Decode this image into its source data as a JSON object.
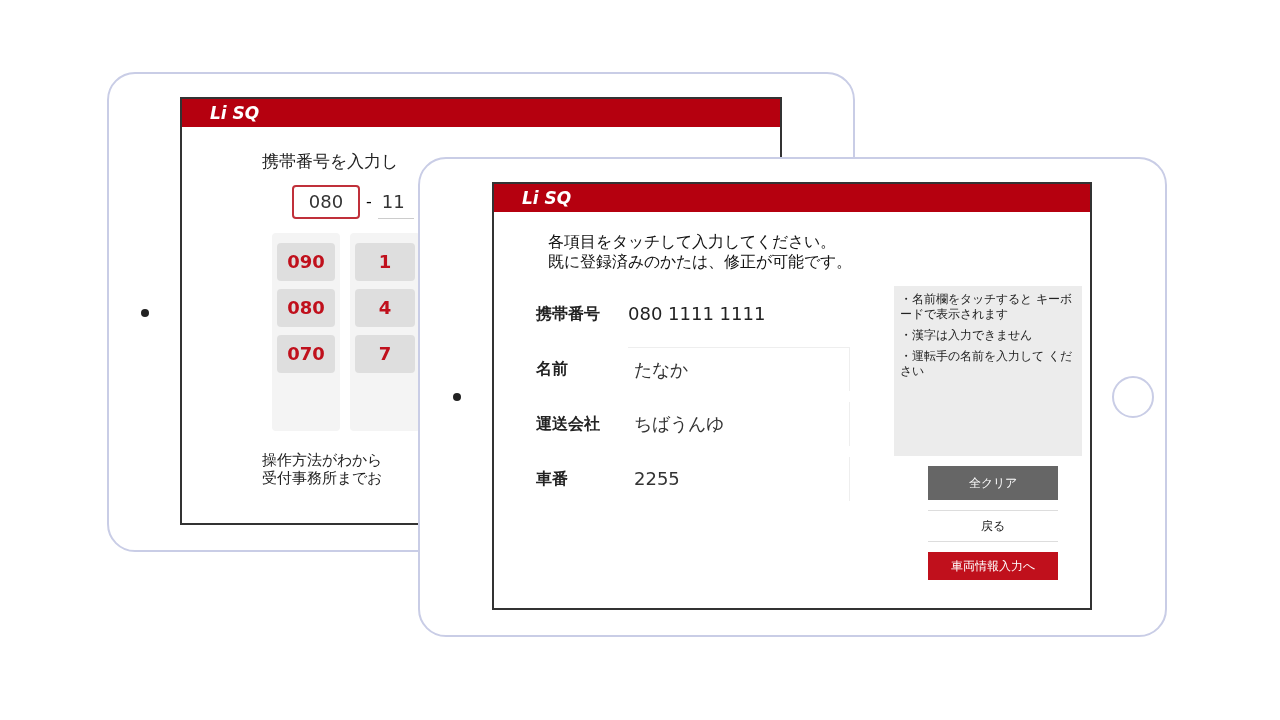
{
  "back_tablet": {
    "logo": "Li SQ",
    "prompt": "携帯番号を入力し",
    "phone_input": {
      "prefix": "080",
      "separator": "-",
      "middle": "11"
    },
    "keypad": {
      "prefix_keys": [
        "090",
        "080",
        "070"
      ],
      "digit_keys": [
        "1",
        "4",
        "7"
      ]
    },
    "help_lines": [
      "操作方法がわから",
      "受付事務所までお"
    ]
  },
  "front_tablet": {
    "logo": "Li SQ",
    "instructions": [
      "各項目をタッチして入力してください。",
      "既に登録済みのかたは、修正が可能です。"
    ],
    "fields": [
      {
        "label": "携帯番号",
        "value": "080 1111 1111",
        "kind": "text"
      },
      {
        "label": "名前",
        "value": "たなか",
        "kind": "input"
      },
      {
        "label": "運送会社",
        "value": "ちばうんゆ",
        "kind": "input"
      },
      {
        "label": "車番",
        "value": "2255",
        "kind": "input"
      }
    ],
    "notes": [
      "・名前欄をタッチすると キーボードで表示されます",
      "・漢字は入力できません",
      "・運転手の名前を入力して ください"
    ],
    "buttons": [
      {
        "label": "全クリア",
        "kind": "dark"
      },
      {
        "label": "戻る",
        "kind": "plain"
      },
      {
        "label": "車両情報入力へ",
        "kind": "primary"
      }
    ]
  }
}
